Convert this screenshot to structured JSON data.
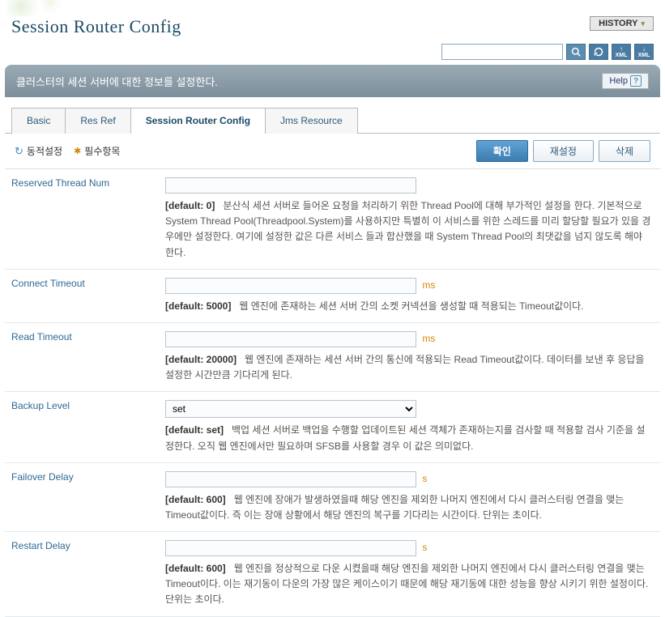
{
  "page_title": "Session Router Config",
  "description": "클러스터의 세션 서버에 대한 정보를 설정한다.",
  "history_label": "HISTORY",
  "help_label": "Help",
  "search": {
    "placeholder": ""
  },
  "tabs": [
    {
      "label": "Basic"
    },
    {
      "label": "Res Ref"
    },
    {
      "label": "Session Router Config"
    },
    {
      "label": "Jms Resource"
    }
  ],
  "legend": {
    "dynamic": "동적설정",
    "required": "필수항목"
  },
  "actions": {
    "confirm": "확인",
    "reset": "재설정",
    "delete": "삭제"
  },
  "fields": {
    "reserved_thread_num": {
      "label": "Reserved Thread Num",
      "value": "",
      "default": "[default: 0]",
      "hint": "분산식 세션 서버로 들어온 요청을 처리하기 위한 Thread Pool에 대해 부가적인 설정을 한다. 기본적으로 System Thread Pool(Threadpool.System)를 사용하지만 특별히 이 서비스를 위한 스레드를 미리 할당할 필요가 있을 경우에만 설정한다. 여기에 설정한 값은 다른 서비스 들과 합산했을 때 System Thread Pool의 최댓값을 넘지 않도록 해야 한다."
    },
    "connect_timeout": {
      "label": "Connect Timeout",
      "value": "",
      "unit": "ms",
      "default": "[default: 5000]",
      "hint": "웹 엔진에 존재하는 세션 서버 간의 소켓 커넥션을 생성할 때 적용되는 Timeout값이다."
    },
    "read_timeout": {
      "label": "Read Timeout",
      "value": "",
      "unit": "ms",
      "default": "[default: 20000]",
      "hint": "웹 엔진에 존재하는 세션 서버 간의 통신에 적용되는 Read Timeout값이다. 데이터를 보낸 후 응답을 설정한 시간만큼 기다리게 된다."
    },
    "backup_level": {
      "label": "Backup Level",
      "value": "set",
      "default": "[default: set]",
      "hint": "백업 세션 서버로 백업을 수행할 업데이트된 세션 객체가 존재하는지를 검사할 때 적용할 검사 기준을 설정한다. 오직 웹 엔진에서만 필요하며 SFSB를 사용할 경우 이 값은 의미없다."
    },
    "failover_delay": {
      "label": "Failover Delay",
      "value": "",
      "unit": "s",
      "default": "[default: 600]",
      "hint": "웹 엔진에 장애가 발생하였을때 해당 엔진을 제외한 나머지 엔진에서 다시 클러스터링 연결을 맺는 Timeout값이다. 즉 이는 장애 상황에서 해당 엔진의 복구를 기다리는 시간이다. 단위는 초이다."
    },
    "restart_delay": {
      "label": "Restart Delay",
      "value": "",
      "unit": "s",
      "default": "[default: 600]",
      "hint": "웹 엔진을 정상적으로 다운 시켰을때 해당 엔진을 제외한 나머지 엔진에서 다시 클러스터링 연결을 맺는 Timeout이다. 이는 재기동이 다운의 가장 많은 케이스이기 때문에 해당 재기동에 대한 성능을 향상 시키기 위한 설정이다. 단위는 초이다."
    }
  },
  "icons": {
    "search": "search-icon",
    "refresh": "refresh-icon",
    "xml_up": "xml-upload-icon",
    "xml_down": "xml-download-icon"
  }
}
